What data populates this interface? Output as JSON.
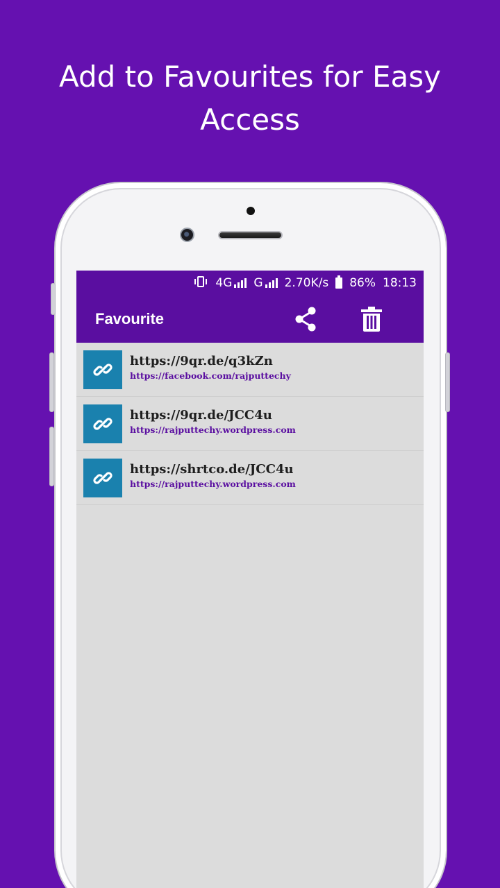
{
  "promo": {
    "headline": "Add to Favourites for Easy Access"
  },
  "status_bar": {
    "network_4g": "4G",
    "network_g": "G",
    "speed": "2.70K/s",
    "battery": "86%",
    "time": "18:13"
  },
  "toolbar": {
    "title": "Favourite",
    "share_icon": "share-icon",
    "delete_icon": "trash-icon"
  },
  "favourites": [
    {
      "short_url": "https://9qr.de/q3kZn",
      "long_url": "https://facebook.com/rajputtechy"
    },
    {
      "short_url": "https://9qr.de/JCC4u",
      "long_url": "https://rajputtechy.wordpress.com"
    },
    {
      "short_url": "https://shrtco.de/JCC4u",
      "long_url": "https://rajputtechy.wordpress.com"
    }
  ],
  "colors": {
    "background": "#6511b0",
    "app_bar": "#5a0ea0",
    "link_thumb": "#1a81ae",
    "list_bg": "#dcdcdc"
  }
}
